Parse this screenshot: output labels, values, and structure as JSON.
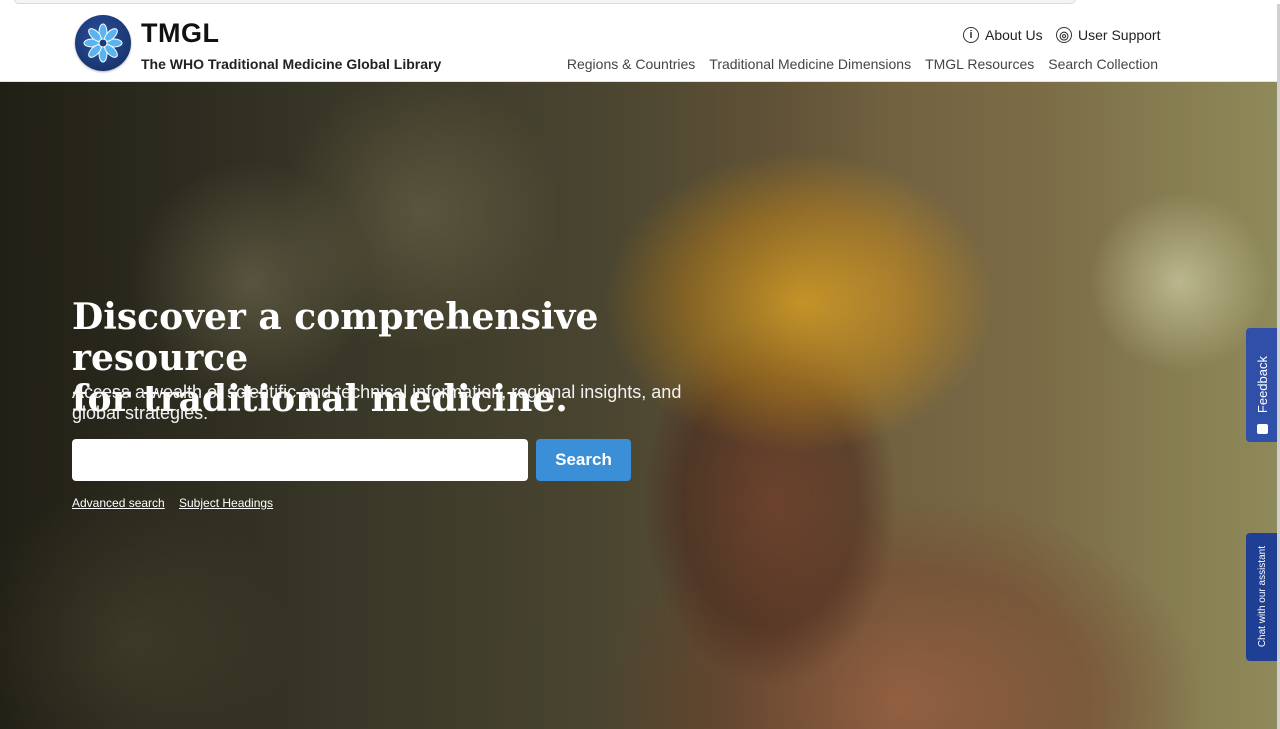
{
  "brand": {
    "title": "TMGL",
    "subtitle": "The WHO Traditional Medicine Global Library",
    "logo_icon": "flower-icon",
    "logo_color": "#1c3a78"
  },
  "utility_links": [
    {
      "label": "About Us",
      "icon": "info-icon"
    },
    {
      "label": "User Support",
      "icon": "lifebuoy-icon"
    }
  ],
  "nav": [
    {
      "label": "Regions & Countries"
    },
    {
      "label": "Traditional Medicine Dimensions"
    },
    {
      "label": "TMGL Resources"
    },
    {
      "label": "Search Collection"
    }
  ],
  "hero": {
    "headline_line1": "Discover a comprehensive resource",
    "headline_line2": "for traditional medicine.",
    "subtext": "Access a wealth of scientific and technical information, regional insights, and global strategies.",
    "search_value": "",
    "search_button": "Search",
    "links": [
      {
        "label": "Advanced search"
      },
      {
        "label": "Subject Headings"
      }
    ],
    "accent_color": "#3a8fd6"
  },
  "side_tabs": {
    "feedback": "Feedback",
    "chat": "Chat with our assistant",
    "color": "#2f4fa8"
  }
}
